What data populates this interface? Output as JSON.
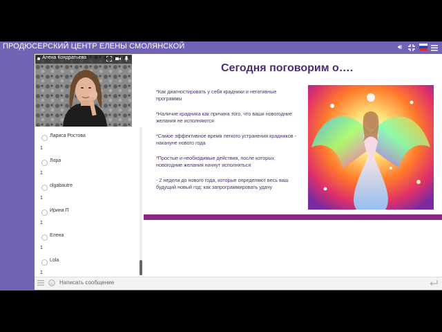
{
  "header": {
    "title": "ПРОДЮСЕРСКИЙ ЦЕНТР ЕЛЕНЫ СМОЛЯНСКОЙ",
    "icons": [
      "volume-icon",
      "exit-fullscreen-icon",
      "flag-ru-icon",
      "menu-icon"
    ]
  },
  "video": {
    "presenter_name": "Алена Кондратьева",
    "icons": [
      "fullscreen-icon",
      "camera-icon",
      "microphone-icon"
    ]
  },
  "users": [
    {
      "name": "Лариса Ростова",
      "message": "1"
    },
    {
      "name": "Лора",
      "message": "1"
    },
    {
      "name": "olgabautre",
      "message": "1"
    },
    {
      "name": "Ирина П",
      "message": "1"
    },
    {
      "name": "Елена",
      "message": "1"
    },
    {
      "name": "Lola",
      "message": "1"
    }
  ],
  "slide": {
    "title": "Сегодня поговорим о….",
    "bullets": [
      "*Как диагностировать у себя крадники и негативные программы",
      "*Наличие крадника как причина того, что ваши новогодние желания не исполняются",
      "*Самое эффективное время легкого устранения крадников - накануне нового года",
      "*Простые и необходимые действия, после которых новогодние желания начнут исполняться",
      "- 2 недели до нового года, которые определяют весь ваш будущий новый год: как запрограммировать удачу"
    ],
    "accent_color": "#8b2a86",
    "title_color": "#4a2d7a"
  },
  "chat": {
    "placeholder": "Написать сообщение",
    "icons": [
      "list-icon",
      "emoji-icon",
      "send-icon"
    ]
  }
}
